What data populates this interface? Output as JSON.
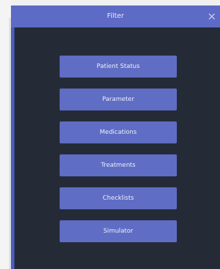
{
  "dialog": {
    "title": "Filter",
    "close_icon": "close-icon"
  },
  "menu": {
    "items": [
      {
        "label": "Patient Status"
      },
      {
        "label": "Parameter"
      },
      {
        "label": "Medications"
      },
      {
        "label": "Treatments"
      },
      {
        "label": "Checklists"
      },
      {
        "label": "Simulator"
      }
    ]
  },
  "colors": {
    "panel_background": "#242b36",
    "header_background": "#5d6bc6",
    "button_background": "#5f6dc4",
    "button_text": "#eef1fb"
  }
}
